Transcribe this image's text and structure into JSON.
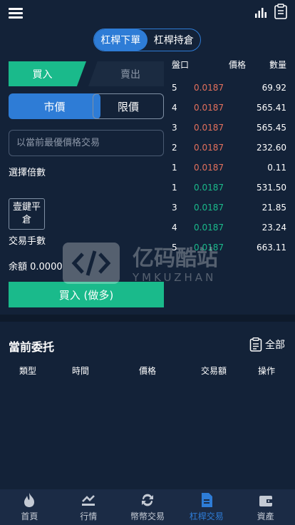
{
  "mode_tabs": [
    "杠桿下單",
    "杠桿持倉"
  ],
  "side_tabs": {
    "buy": "買入",
    "sell": "賣出"
  },
  "order_types": {
    "market": "市價",
    "limit": "限價"
  },
  "price_input": {
    "placeholder": "以當前最優價格交易",
    "value": ""
  },
  "labels": {
    "leverage": "選擇倍數",
    "one_click_close": "壹鍵平倉",
    "lot_size": "交易手數",
    "balance": "余額 0.0000"
  },
  "action_button": "買入 (做多)",
  "order_book": {
    "headers": {
      "level": "盤口",
      "price": "價格",
      "amount": "數量"
    },
    "asks": [
      {
        "level": "5",
        "price": "0.0187",
        "amount": "69.92"
      },
      {
        "level": "4",
        "price": "0.0187",
        "amount": "565.41"
      },
      {
        "level": "3",
        "price": "0.0187",
        "amount": "565.45"
      },
      {
        "level": "2",
        "price": "0.0187",
        "amount": "232.60"
      },
      {
        "level": "1",
        "price": "0.0187",
        "amount": "0.11"
      }
    ],
    "bids": [
      {
        "level": "1",
        "price": "0.0187",
        "amount": "531.50"
      },
      {
        "level": "3",
        "price": "0.0187",
        "amount": "21.85"
      },
      {
        "level": "4",
        "price": "0.0187",
        "amount": "23.24"
      },
      {
        "level": "5",
        "price": "0.0187",
        "amount": "663.11"
      }
    ]
  },
  "watermark": {
    "text": "亿码酷站",
    "sub": "YMKUZHAN"
  },
  "orders": {
    "title": "當前委托",
    "all_label": "全部",
    "columns": [
      "類型",
      "時間",
      "價格",
      "交易額",
      "操作"
    ]
  },
  "bottom_nav": [
    {
      "label": "首頁",
      "icon": "fire-icon"
    },
    {
      "label": "行情",
      "icon": "market-icon"
    },
    {
      "label": "幣幣交易",
      "icon": "exchange-icon"
    },
    {
      "label": "杠桿交易",
      "icon": "leverage-doc-icon"
    },
    {
      "label": "資產",
      "icon": "wallet-icon"
    }
  ],
  "colors": {
    "background": "#132238",
    "accent_blue": "#2e7cd6",
    "buy_green": "#1aba8b",
    "sell_red": "#e4705c",
    "tabbar": "#1b2b45"
  }
}
